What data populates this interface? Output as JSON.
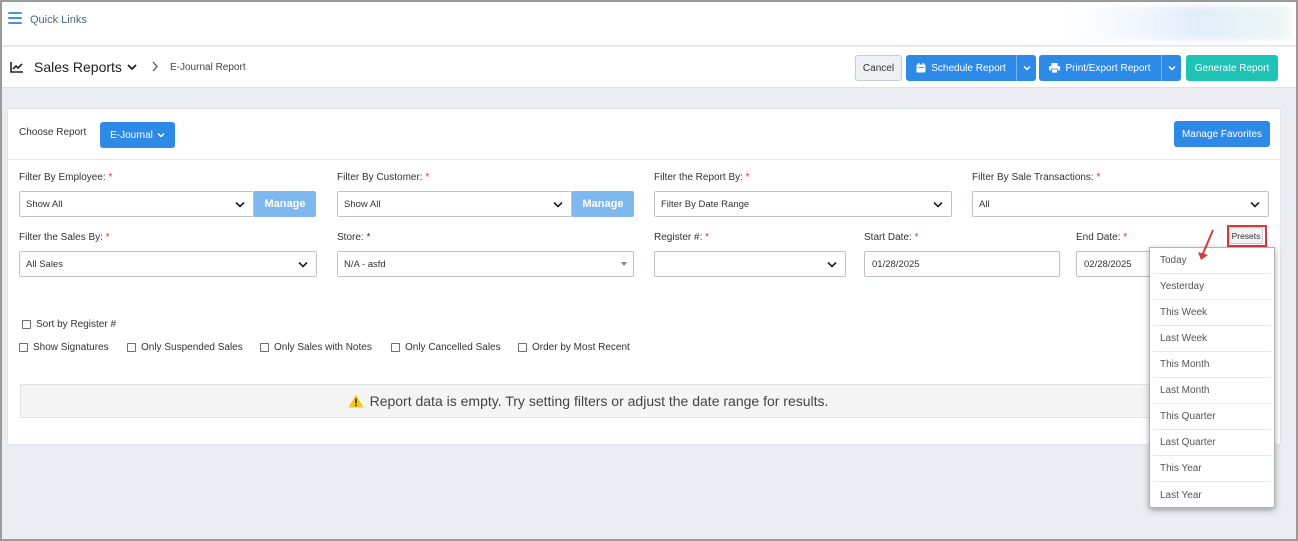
{
  "quicklinks": {
    "label": "Quick Links"
  },
  "header": {
    "title": "Sales Reports",
    "subtitle": "E-Journal Report",
    "cancel_label": "Cancel",
    "schedule_label": "Schedule Report",
    "print_label": "Print/Export Report",
    "generate_label": "Generate Report"
  },
  "card": {
    "choose_report_label": "Choose Report",
    "report_selected": "E-Journal",
    "manage_favorites_label": "Manage Favorites"
  },
  "filters": {
    "employee": {
      "label": "Filter By Employee:",
      "value": "Show All",
      "manage_label": "Manage"
    },
    "customer": {
      "label": "Filter By Customer:",
      "value": "Show All",
      "manage_label": "Manage"
    },
    "report_by": {
      "label": "Filter the Report By:",
      "value": "Filter By Date Range"
    },
    "sale_transactions": {
      "label": "Filter By Sale Transactions:",
      "value": "All"
    },
    "sales_by": {
      "label": "Filter the Sales By:",
      "value": "All Sales"
    },
    "store": {
      "label": "Store:",
      "value": "N/A - asfd"
    },
    "register": {
      "label": "Register #:",
      "value": ""
    },
    "start_date": {
      "label": "Start Date:",
      "value": "01/28/2025"
    },
    "end_date": {
      "label": "End Date:",
      "value": "02/28/2025"
    },
    "presets_label": "Presets",
    "required_mark": "*"
  },
  "checkboxes": {
    "sort_register": "Sort by Register #",
    "show_signatures": "Show Signatures",
    "only_suspended": "Only Suspended Sales",
    "only_notes": "Only Sales with Notes",
    "only_cancelled": "Only Cancelled Sales",
    "order_recent": "Order by Most Recent"
  },
  "empty_message": "Report data is empty. Try setting filters or adjust the date range for results.",
  "presets_menu": [
    "Today",
    "Yesterday",
    "This Week",
    "Last Week",
    "This Month",
    "Last Month",
    "This Quarter",
    "Last Quarter",
    "This Year",
    "Last Year"
  ],
  "colors": {
    "primary": "#2d8ae6",
    "generate": "#1fc3b6",
    "manage": "#7fb8ef",
    "required": "#d9342b",
    "highlight": "#d43b3b"
  }
}
